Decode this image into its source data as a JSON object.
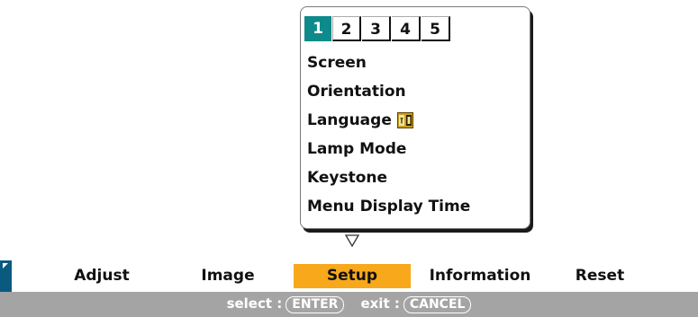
{
  "submenu": {
    "tabs": [
      {
        "label": "1",
        "active": true
      },
      {
        "label": "2",
        "active": false
      },
      {
        "label": "3",
        "active": false
      },
      {
        "label": "4",
        "active": false
      },
      {
        "label": "5",
        "active": false
      }
    ],
    "items": [
      {
        "label": "Screen"
      },
      {
        "label": "Orientation"
      },
      {
        "label": "Language",
        "icon": "language-icon"
      },
      {
        "label": "Lamp Mode"
      },
      {
        "label": "Keystone"
      },
      {
        "label": "Menu Display Time"
      }
    ],
    "more_indicator_icon": "down-triangle-icon"
  },
  "main_menu": {
    "items": [
      {
        "label": "Adjust",
        "selected": false
      },
      {
        "label": "Image",
        "selected": false
      },
      {
        "label": "Setup",
        "selected": true
      },
      {
        "label": "Information",
        "selected": false
      },
      {
        "label": "Reset",
        "selected": false
      }
    ]
  },
  "status": {
    "select_label": "select :",
    "select_key": "ENTER",
    "exit_label": "exit :",
    "exit_key": "CANCEL"
  },
  "colors": {
    "tab_active": "#0e8a8a",
    "menu_selected": "#f7a81b",
    "status_bar": "#a4a4a4",
    "left_edge": "#0a5a80"
  }
}
